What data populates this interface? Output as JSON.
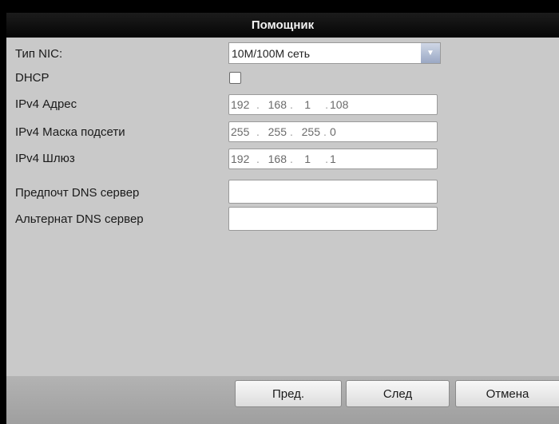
{
  "dialog": {
    "title": "Помощник"
  },
  "form": {
    "nic_type": {
      "label": "Тип NIC:",
      "value": "10M/100M сеть"
    },
    "dhcp": {
      "label": "DHCP",
      "checked": false
    },
    "ipv4_address": {
      "label": "IPv4 Адрес",
      "octets": [
        "192",
        "168",
        "1",
        "108"
      ]
    },
    "ipv4_mask": {
      "label": "IPv4 Маска подсети",
      "octets": [
        "255",
        "255",
        "255",
        "0"
      ]
    },
    "ipv4_gateway": {
      "label": "IPv4 Шлюз",
      "octets": [
        "192",
        "168",
        "1",
        "1"
      ]
    },
    "preferred_dns": {
      "label": "Предпочт DNS сервер",
      "value": ""
    },
    "alternate_dns": {
      "label": "Альтернат DNS сервер",
      "value": ""
    }
  },
  "buttons": {
    "prev": "Пред.",
    "next": "След",
    "cancel": "Отмена"
  },
  "icons": {
    "dropdown": "chevron-down-icon"
  }
}
